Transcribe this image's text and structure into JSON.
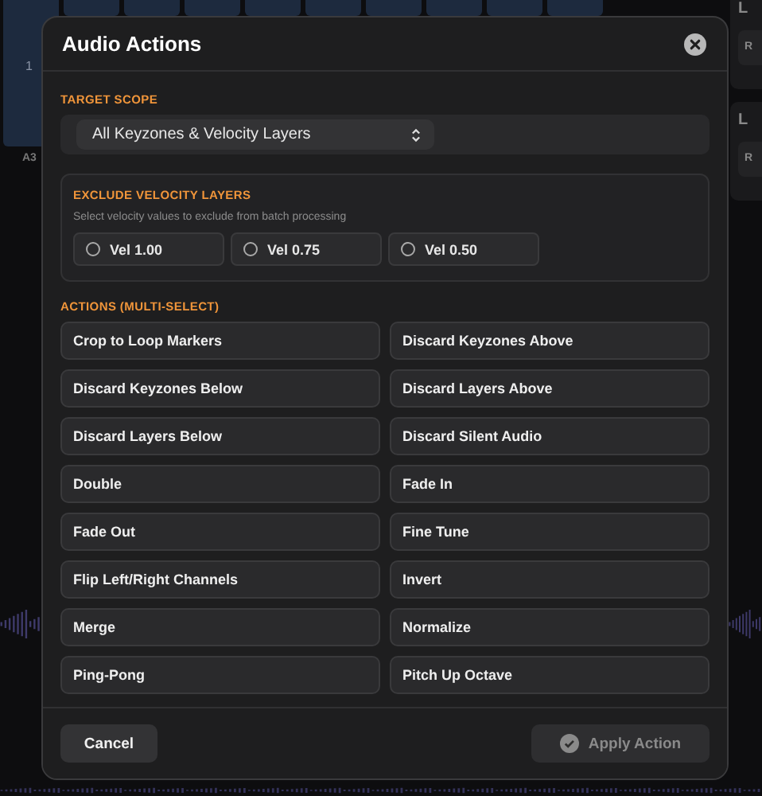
{
  "background": {
    "key_label": "1",
    "note_label": "A3",
    "side_panels": [
      {
        "title": "L",
        "button": "R"
      },
      {
        "title": "L",
        "button": "R"
      }
    ]
  },
  "dialog": {
    "title": "Audio Actions",
    "target_scope": {
      "label": "TARGET SCOPE",
      "value": "All Keyzones & Velocity Layers"
    },
    "exclude": {
      "label": "EXCLUDE VELOCITY LAYERS",
      "hint": "Select velocity values to exclude from batch processing",
      "options": [
        {
          "label": "Vel 1.00",
          "checked": false
        },
        {
          "label": "Vel 0.75",
          "checked": false
        },
        {
          "label": "Vel 0.50",
          "checked": false
        }
      ]
    },
    "actions_label": "ACTIONS (MULTI-SELECT)",
    "actions": [
      {
        "label": "Crop to Loop Markers",
        "selected": false
      },
      {
        "label": "Discard Keyzones Above",
        "selected": false
      },
      {
        "label": "Discard Keyzones Below",
        "selected": false
      },
      {
        "label": "Discard Layers Above",
        "selected": false
      },
      {
        "label": "Discard Layers Below",
        "selected": false
      },
      {
        "label": "Discard Silent Audio",
        "selected": false
      },
      {
        "label": "Double",
        "selected": false
      },
      {
        "label": "Fade In",
        "selected": false
      },
      {
        "label": "Fade Out",
        "selected": false
      },
      {
        "label": "Fine Tune",
        "selected": false
      },
      {
        "label": "Flip Left/Right Channels",
        "selected": false
      },
      {
        "label": "Invert",
        "selected": false
      },
      {
        "label": "Merge",
        "selected": false
      },
      {
        "label": "Normalize",
        "selected": false
      },
      {
        "label": "Ping-Pong",
        "selected": false
      },
      {
        "label": "Pitch Up Octave",
        "selected": false
      }
    ],
    "cancel": "Cancel",
    "apply": {
      "label": "Apply Action",
      "disabled": true
    }
  }
}
